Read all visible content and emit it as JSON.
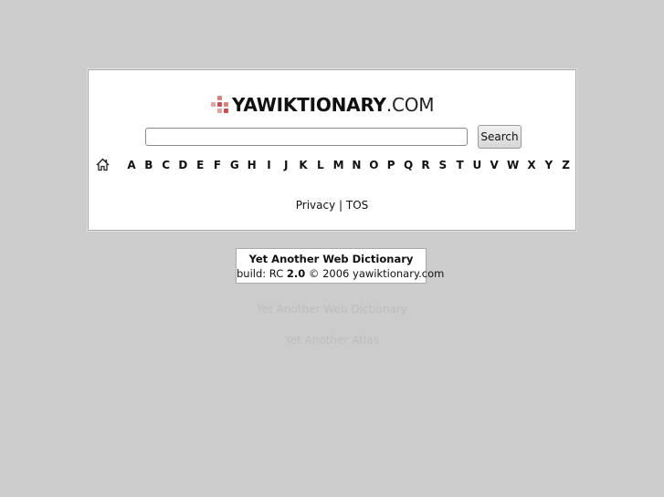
{
  "logo": {
    "brand": "YAWIKTIONARY",
    "tld": ".COM",
    "icon": "red-dots-icon",
    "icon_colors": [
      "#c94f4f",
      "#d98080",
      "#e0a3a3"
    ]
  },
  "search": {
    "value": "",
    "placeholder": "",
    "button_label": "Search"
  },
  "nav": {
    "home_icon": "home-icon",
    "letters": [
      "A",
      "B",
      "C",
      "D",
      "E",
      "F",
      "G",
      "H",
      "I",
      "J",
      "K",
      "L",
      "M",
      "N",
      "O",
      "P",
      "Q",
      "R",
      "S",
      "T",
      "U",
      "V",
      "W",
      "X",
      "Y",
      "Z"
    ]
  },
  "footer": {
    "privacy": "Privacy",
    "separator": " | ",
    "tos": "TOS"
  },
  "info": {
    "title": "Yet Another Web Dictionary",
    "build_prefix": "build: RC ",
    "version": "2.0",
    "copyright": " © 2006 yawiktionary.com"
  },
  "related": {
    "link1": "Yet Another Web Dictionary",
    "link2": "Yet Another Atlas"
  },
  "colors": {
    "background": "#cccccc",
    "panel": "#ffffff",
    "faded_text": "#bdbdbd"
  }
}
